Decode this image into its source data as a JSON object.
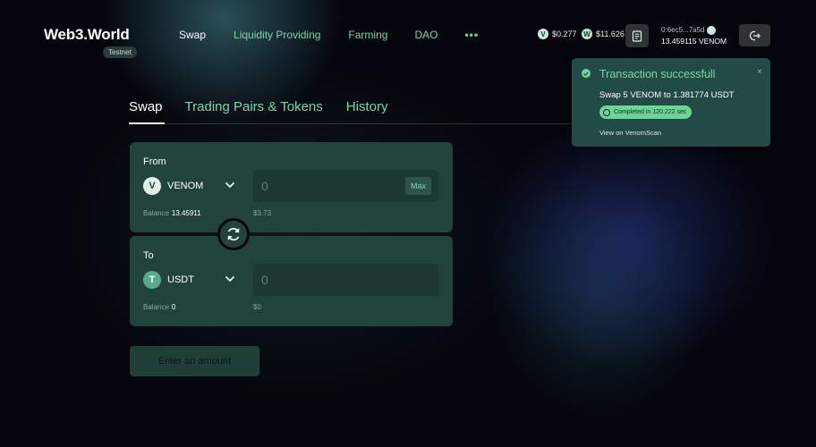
{
  "header": {
    "logo": "Web3.World",
    "network_badge": "Testnet",
    "nav": [
      "Swap",
      "Liquidity Providing",
      "Farming",
      "DAO",
      "•••"
    ],
    "prices": [
      {
        "icon": "venom-coin-icon",
        "value": "$0.277"
      },
      {
        "icon": "web3world-coin-icon",
        "value": "$11.626"
      }
    ],
    "wallet": {
      "address": "0:6ec5...7a5d",
      "balance": "13.459115 VENOM"
    }
  },
  "tabs": [
    "Swap",
    "Trading Pairs & Tokens",
    "History"
  ],
  "from": {
    "label": "From",
    "token": "VENOM",
    "amount_placeholder": "0",
    "max_label": "Max",
    "balance_label": "Balance",
    "balance_value": "13.45911",
    "usd_value": "$3.73"
  },
  "to": {
    "label": "To",
    "token": "USDT",
    "amount_placeholder": "0",
    "balance_label": "Balance",
    "balance_value": "0",
    "usd_value": "$0"
  },
  "submit_label": "Enter an amount",
  "toast": {
    "title": "Transaction successfull",
    "message": "Swap 5 VENOM to 1.381774 USDT",
    "badge": "Completed in 120.222 sec",
    "link": "View on VenomScan",
    "close": "×"
  },
  "colors": {
    "accent": "#7fd3a8",
    "card": "#22433c",
    "background": "#05060d",
    "success": "#6fd49a"
  }
}
